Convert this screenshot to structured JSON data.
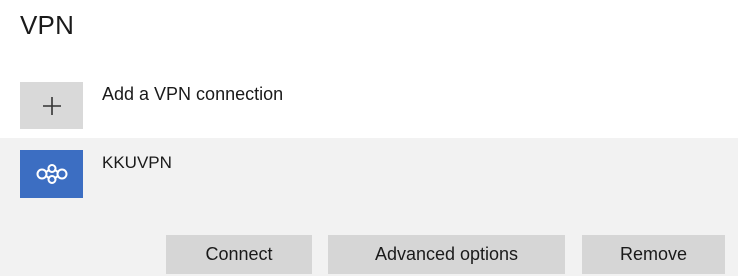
{
  "page": {
    "title": "VPN"
  },
  "add_connection": {
    "icon": "plus-icon",
    "label": "Add a VPN connection"
  },
  "connection": {
    "icon": "vpn-connection-icon",
    "icon_color": "#3c6ec2",
    "name": "KKUVPN",
    "buttons": {
      "connect": "Connect",
      "advanced": "Advanced options",
      "remove": "Remove"
    }
  }
}
